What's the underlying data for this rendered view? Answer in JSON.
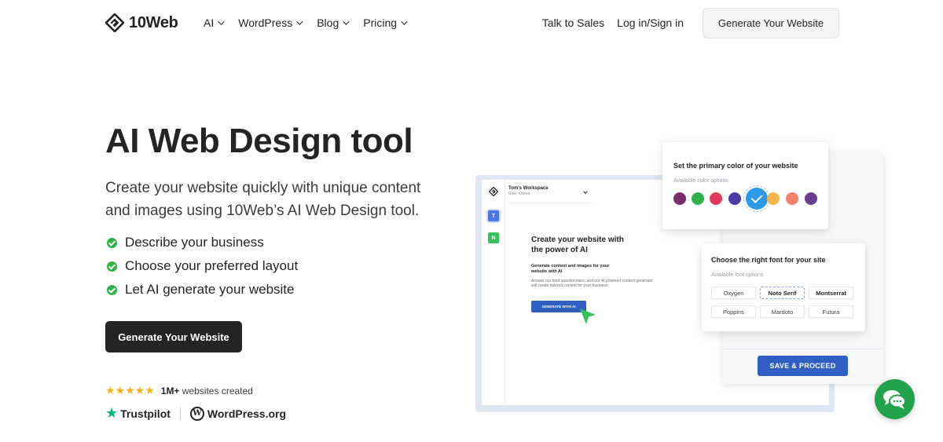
{
  "header": {
    "logo_text": "10Web",
    "nav": [
      {
        "label": "AI"
      },
      {
        "label": "WordPress"
      },
      {
        "label": "Blog"
      },
      {
        "label": "Pricing"
      }
    ],
    "talk_to_sales": "Talk to Sales",
    "login": "Log in/Sign in",
    "cta": "Generate Your Website"
  },
  "hero": {
    "title": "AI Web Design tool",
    "subtitle": "Create your website quickly with unique content and images using 10Web’s AI Web Design tool.",
    "features": [
      "Describe your business",
      "Choose your preferred layout",
      "Let AI generate your website"
    ],
    "cta": "Generate Your Website",
    "rating": {
      "stars": "★★★★★",
      "count": "1M+",
      "text": "websites created"
    },
    "brands": {
      "trustpilot": "Trustpilot",
      "wordpress": "WordPress.org"
    }
  },
  "mockup": {
    "workspace_name": "Tom's Workspace",
    "workspace_role": "Role: Owner",
    "side_tiles": [
      "T",
      "N"
    ],
    "heading": "Create your website with the power of AI",
    "subheading": "Generate content and images for your website with AI",
    "paragraph": "Answer our brief questionnaire, and our AI-powered content generator will create tailored content for your business.",
    "button": "GENERATE WITH AI",
    "color_card": {
      "title": "Set the primary color of your website",
      "subtitle": "Available color options",
      "swatches": [
        "#7b2c6b",
        "#2fb34a",
        "#e23a5a",
        "#4b3aa8",
        "#f4b54a",
        "#f57f6c",
        "#6a3f8f"
      ],
      "selected": "#2b9be9"
    },
    "font_card": {
      "title": "Choose the right font for your site",
      "subtitle": "Available font options",
      "fonts": [
        "Oxygen",
        "Noto Serif",
        "Montserrat",
        "Poppins",
        "Mardoto",
        "Futura"
      ]
    },
    "proceed_button": "SAVE & PROCEED"
  },
  "colors": {
    "accent_dark": "#222426",
    "check_green": "#2fb34a",
    "star_yellow": "#f6b21b",
    "primary_blue": "#2f5fc2",
    "chat_green": "#22a24a"
  }
}
